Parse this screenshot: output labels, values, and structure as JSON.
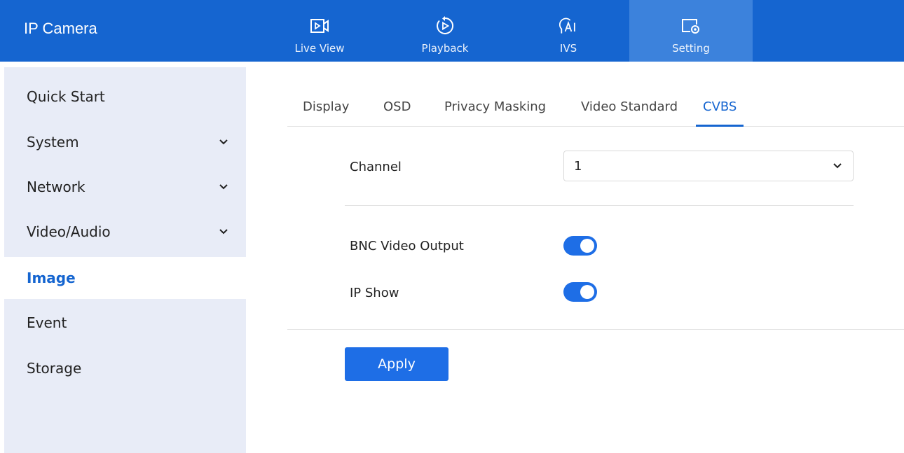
{
  "app": {
    "title": "IP Camera"
  },
  "nav": {
    "tabs": [
      {
        "label": "Live View",
        "icon": "live-view-icon"
      },
      {
        "label": "Playback",
        "icon": "playback-icon"
      },
      {
        "label": "IVS",
        "icon": "ai-icon"
      },
      {
        "label": "Setting",
        "icon": "setting-icon",
        "active": true
      }
    ]
  },
  "sidebar": {
    "items": [
      {
        "label": "Quick Start"
      },
      {
        "label": "System",
        "expandable": true
      },
      {
        "label": "Network",
        "expandable": true
      },
      {
        "label": "Video/Audio",
        "expandable": true
      },
      {
        "label": "Image",
        "active": true
      },
      {
        "label": "Event"
      },
      {
        "label": "Storage"
      }
    ]
  },
  "tabs": [
    {
      "label": "Display"
    },
    {
      "label": "OSD"
    },
    {
      "label": "Privacy Masking"
    },
    {
      "label": "Video Standard"
    },
    {
      "label": "CVBS",
      "active": true
    }
  ],
  "form": {
    "channel_label": "Channel",
    "channel_value": "1",
    "bnc_label": "BNC Video Output",
    "bnc_enabled": true,
    "ipshow_label": "IP Show",
    "ipshow_enabled": true,
    "apply_label": "Apply"
  },
  "colors": {
    "brand": "#1565d0",
    "accent": "#1e6ee6",
    "sidebar_bg": "#e8ecf7"
  }
}
